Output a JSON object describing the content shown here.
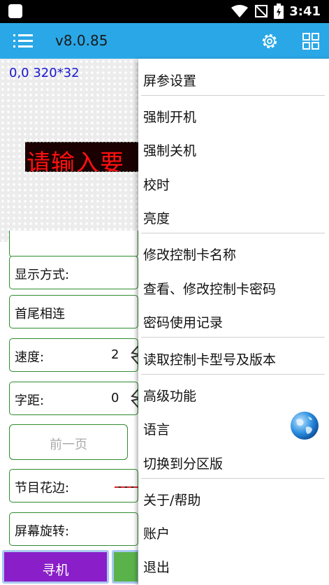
{
  "status_bar": {
    "time": "3:41"
  },
  "app_bar": {
    "title": "v8.0.85"
  },
  "led": {
    "coords": "0,0 320*32",
    "text": "请输入要"
  },
  "form": {
    "display_mode_label": "显示方式:",
    "head_tail_label": "首尾相连",
    "speed_label": "速度:",
    "speed_value": "2",
    "spacing_label": "字距:",
    "spacing_value": "0",
    "prev_page_label": "前一页",
    "border_label": "节目花边:",
    "rotation_label": "屏幕旋转:"
  },
  "bottom": {
    "search_label": "寻机"
  },
  "menu": {
    "items": [
      {
        "label": "屏参设置"
      },
      {
        "label": "强制开机"
      },
      {
        "label": "强制关机"
      },
      {
        "label": "校时"
      },
      {
        "label": "亮度"
      },
      {
        "label": "修改控制卡名称"
      },
      {
        "label": "查看、修改控制卡密码"
      },
      {
        "label": "密码使用记录"
      },
      {
        "label": "读取控制卡型号及版本"
      },
      {
        "label": "高级功能"
      },
      {
        "label": "语言"
      },
      {
        "label": "切换到分区版"
      },
      {
        "label": "关于/帮助"
      },
      {
        "label": "账户"
      },
      {
        "label": "退出"
      }
    ]
  },
  "colors": {
    "app_bar": "#2aa7e6",
    "led_text": "#ff1010",
    "cell_border": "#2e8b2e",
    "search_button": "#8a1ec8",
    "green_button": "#5ab24a"
  },
  "icons": [
    "menu-list-icon",
    "gear-icon",
    "grid-icon",
    "globe-icon",
    "wifi-icon",
    "battery-icon"
  ]
}
